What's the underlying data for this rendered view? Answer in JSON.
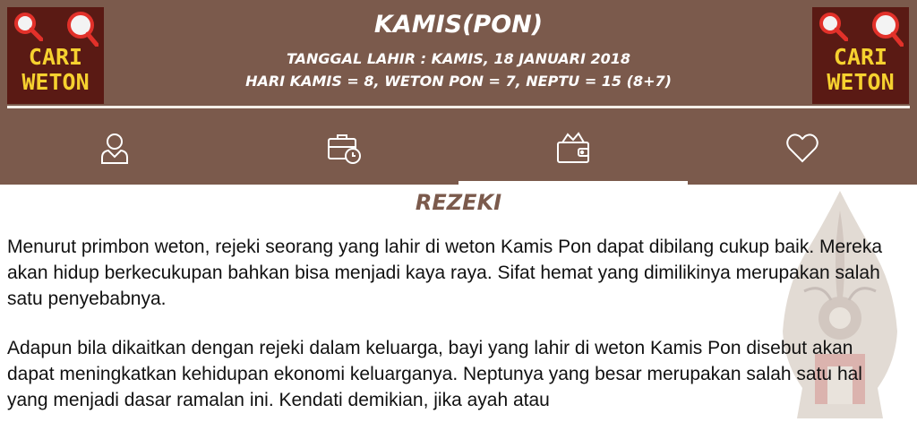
{
  "logo": {
    "line1": "CARI",
    "line2": "WETON"
  },
  "header": {
    "title": "KAMIS(PON)",
    "date_line": "TANGGAL LAHIR : KAMIS, 18 JANUARI 2018",
    "neptu_line": "HARI KAMIS = 8, WETON PON = 7, NEPTU = 15 (8+7)"
  },
  "tabs": [
    {
      "icon": "person-icon"
    },
    {
      "icon": "briefcase-clock-icon"
    },
    {
      "icon": "wallet-icon",
      "selected": true
    },
    {
      "icon": "heart-icon"
    }
  ],
  "section": {
    "title": "REZEKI"
  },
  "content": {
    "paragraph1": "Menurut primbon weton, rejeki seorang yang lahir di weton Kamis Pon dapat dibilang cukup baik. Mereka akan hidup berkecukupan bahkan bisa menjadi kaya raya. Sifat hemat yang dimilikinya merupakan salah satu penyebabnya.",
    "paragraph2": "Adapun bila dikaitkan dengan rejeki dalam keluarga, bayi yang lahir di weton Kamis Pon disebut akan dapat meningkatkan kehidupan ekonomi keluarganya. Neptunya yang besar merupakan salah satu hal yang menjadi dasar ramalan ini. Kendati demikian, jika ayah atau"
  },
  "colors": {
    "brown": "#7b5a4c",
    "logo_bg": "#5a1a14",
    "logo_text": "#f6d12f"
  }
}
